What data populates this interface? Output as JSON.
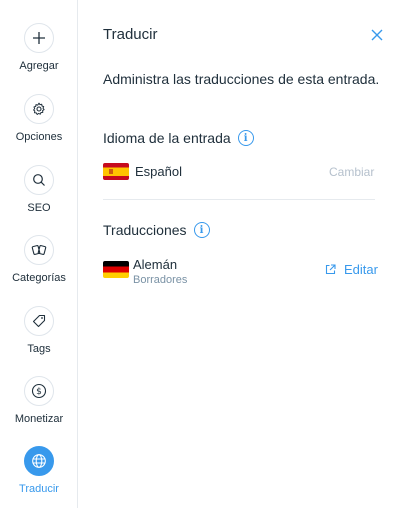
{
  "sidebar": {
    "items": [
      {
        "label": "Agregar",
        "icon": "plus-icon"
      },
      {
        "label": "Opciones",
        "icon": "gear-icon"
      },
      {
        "label": "SEO",
        "icon": "search-icon"
      },
      {
        "label": "Categorías",
        "icon": "cards-icon"
      },
      {
        "label": "Tags",
        "icon": "tag-icon"
      },
      {
        "label": "Monetizar",
        "icon": "dollar-icon"
      },
      {
        "label": "Traducir",
        "icon": "globe-icon",
        "active": true
      }
    ]
  },
  "panel": {
    "title": "Traducir",
    "description": "Administra las traducciones de esta entrada.",
    "entry_language": {
      "heading": "Idioma de la entrada",
      "language": "Español",
      "change_label": "Cambiar"
    },
    "translations": {
      "heading": "Traducciones",
      "items": [
        {
          "language": "Alemán",
          "status": "Borradores",
          "edit_label": "Editar"
        }
      ]
    }
  },
  "colors": {
    "accent": "#3899ec",
    "text": "#20303c",
    "muted": "#b6c1cd"
  }
}
